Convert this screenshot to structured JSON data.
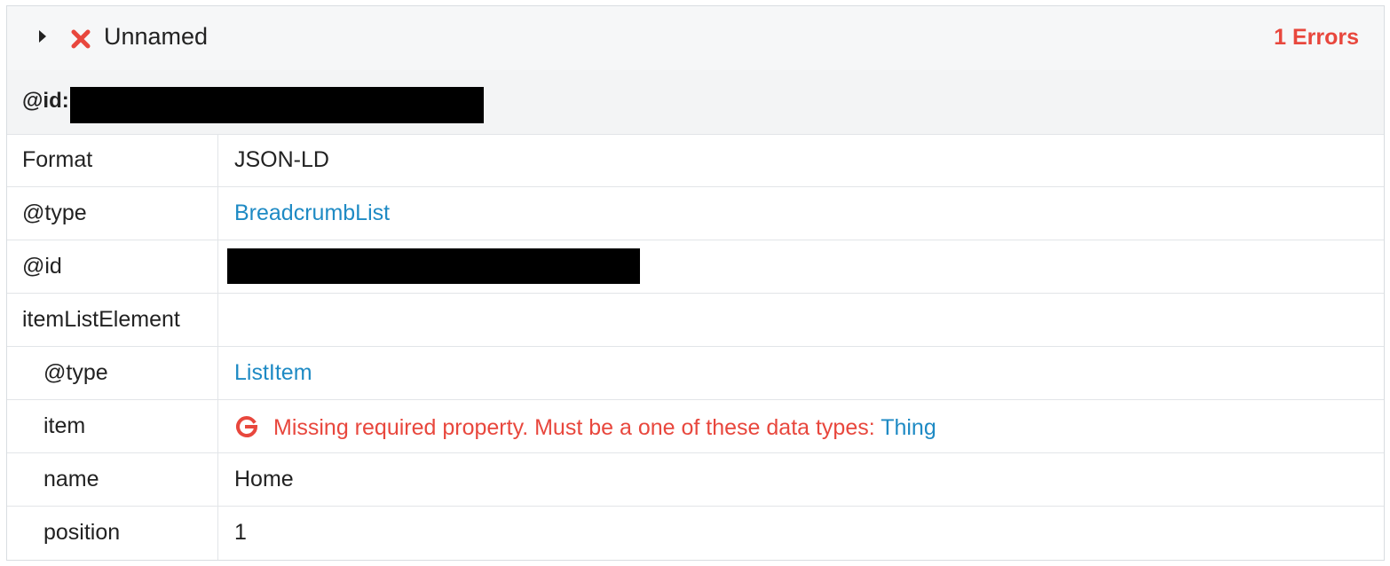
{
  "header": {
    "title": "Unnamed",
    "error_count": "1 Errors",
    "expand_icon": "caret-right-icon",
    "status_icon": "x-icon"
  },
  "id_row": {
    "label": "@id:",
    "value_redacted": true
  },
  "rows": [
    {
      "key": "Format",
      "value": "JSON-LD"
    },
    {
      "key": "@type",
      "value": "BreadcrumbList"
    },
    {
      "key": "@id",
      "value_redacted": true
    },
    {
      "key": "itemListElement",
      "value": ""
    },
    {
      "key": "@type",
      "value": "ListItem"
    },
    {
      "key": "item",
      "error_icon": "google-g-icon",
      "error_text": "Missing required property. Must be a one of these data types: ",
      "error_link": "Thing"
    },
    {
      "key": "name",
      "value": "Home"
    },
    {
      "key": "position",
      "value": "1"
    }
  ],
  "colors": {
    "error": "#e8473d",
    "link": "#1e8ac4",
    "header_bg": "#f6f7f8"
  }
}
